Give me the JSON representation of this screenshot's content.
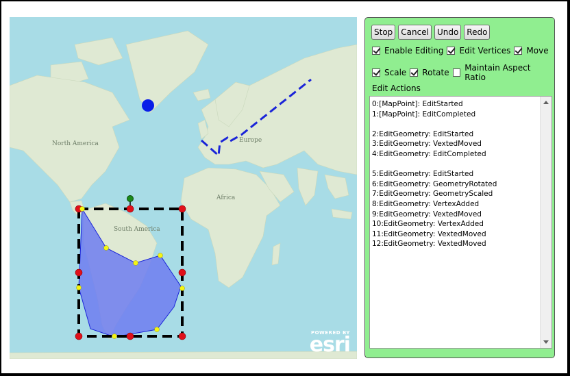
{
  "toolbar": {
    "stop_label": "Stop",
    "cancel_label": "Cancel",
    "undo_label": "Undo",
    "redo_label": "Redo"
  },
  "options": {
    "enable_editing": {
      "label": "Enable Editing",
      "checked": true
    },
    "edit_vertices": {
      "label": "Edit Vertices",
      "checked": true
    },
    "move": {
      "label": "Move",
      "checked": true
    },
    "scale": {
      "label": "Scale",
      "checked": true
    },
    "rotate": {
      "label": "Rotate",
      "checked": true
    },
    "maintain_aspect_ratio": {
      "label": "Maintain Aspect Ratio",
      "checked": false
    }
  },
  "edit_actions": {
    "label": "Edit Actions",
    "lines": [
      "0:[MapPoint]: EditStarted",
      "1:[MapPoint]: EditCompleted",
      "",
      "2:EditGeometry: EditStarted",
      "3:EditGeometry: VextedMoved",
      "4:EditGeometry: EditCompleted",
      "",
      "5:EditGeometry: EditStarted",
      "6:EditGeometry: GeometryRotated",
      "7:EditGeometry: GeometryScaled",
      "8:EditGeometry: VertexAdded",
      "9:EditGeometry: VextedMoved",
      "10:EditGeometry: VertexAdded",
      "11:EditGeometry: VextedMoved",
      "12:EditGeometry: VextedMoved"
    ]
  },
  "map": {
    "labels": {
      "north_america": "North America",
      "south_america": "South America",
      "europe": "Europe",
      "africa": "Africa"
    },
    "logo": {
      "powered_by": "POWERED BY",
      "brand": "esri"
    },
    "colors": {
      "ocean": "#a8dce6",
      "land": "#dfe9d3",
      "polygon_fill": "#6f7df0",
      "point": "#0a1ee8",
      "polyline": "#1a24d8",
      "handle_red": "#e0101a",
      "handle_yellow": "#f5f514",
      "rotate_handle": "#1a8a1a"
    }
  },
  "panel": {
    "background": "#90ee90"
  }
}
